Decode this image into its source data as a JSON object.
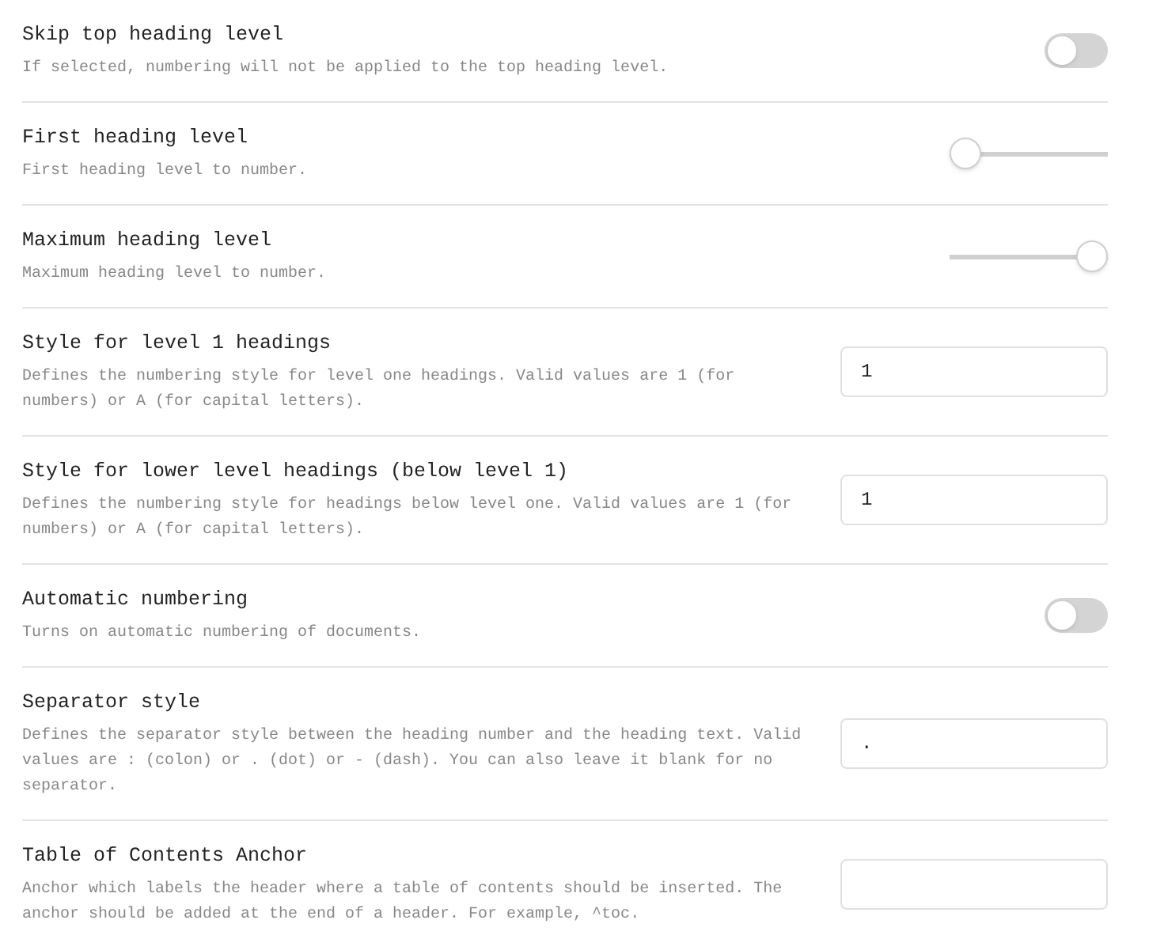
{
  "settings": [
    {
      "kind": "toggle",
      "title": "Skip top heading level",
      "description": "If selected, numbering will not be applied to the top heading level.",
      "on": false
    },
    {
      "kind": "slider",
      "title": "First heading level",
      "description": "First heading level to number.",
      "level": 0
    },
    {
      "kind": "slider",
      "title": "Maximum heading level",
      "description": "Maximum heading level to number.",
      "level": 1
    },
    {
      "kind": "text",
      "title": "Style for level 1 headings",
      "description": "Defines the numbering style for level one headings. Valid values are 1 (for numbers) or A (for capital letters).",
      "value": "1"
    },
    {
      "kind": "text",
      "title": "Style for lower level headings (below level 1)",
      "description": "Defines the numbering style for headings below level one. Valid values are 1 (for numbers) or A (for capital letters).",
      "value": "1"
    },
    {
      "kind": "toggle",
      "title": "Automatic numbering",
      "description": "Turns on automatic numbering of documents.",
      "on": false
    },
    {
      "kind": "text",
      "title": "Separator style",
      "description": "Defines the separator style between the heading number and the heading text. Valid values are : (colon) or . (dot) or - (dash). You can also leave it blank for no separator.",
      "value": "."
    },
    {
      "kind": "text",
      "title": "Table of Contents Anchor",
      "description": "Anchor which labels the header where a table of contents should be inserted. The anchor should be added at the end of a header. For example, ^toc."
    }
  ]
}
